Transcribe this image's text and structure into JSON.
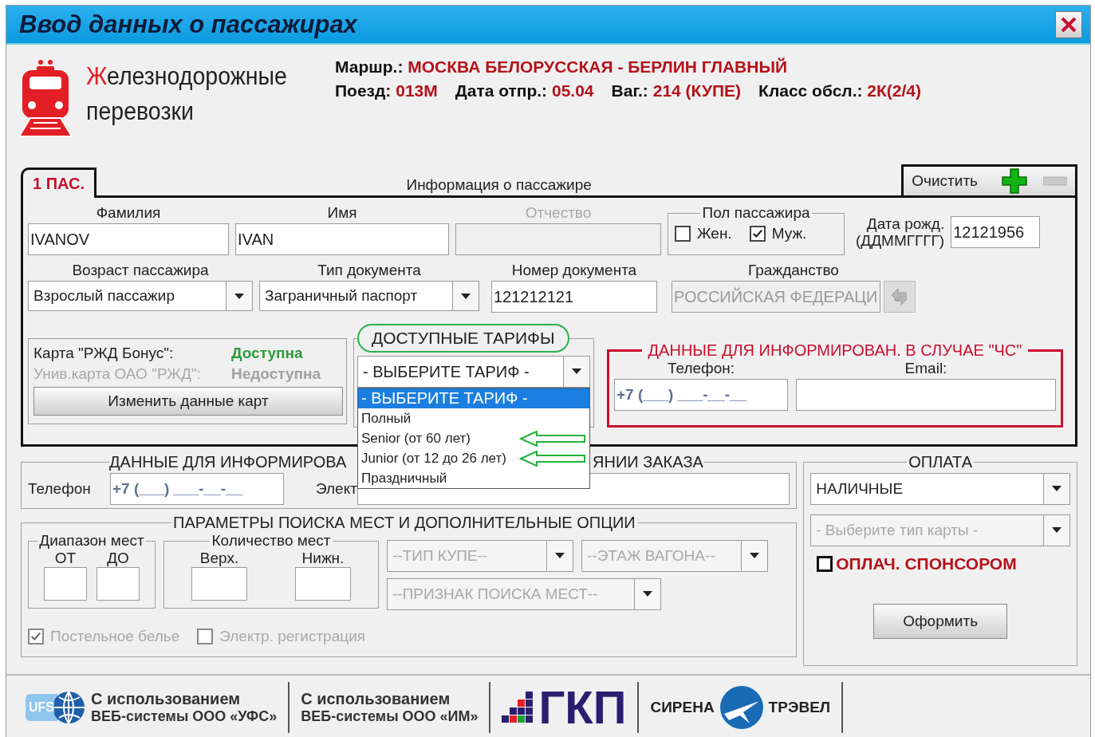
{
  "window": {
    "title": "Ввод данных о пассажирах"
  },
  "brand": {
    "lines": [
      "Железнодорожные",
      "перевозки"
    ]
  },
  "trip_lines": [
    [
      {
        "label": "Маршр.:",
        "value": "МОСКВА БЕЛОРУССКАЯ - БЕРЛИН ГЛАВНЫЙ"
      }
    ],
    [
      {
        "label": "Поезд:",
        "value": "013М"
      },
      {
        "label": "Дата отпр.:",
        "value": "05.04"
      },
      {
        "label": "Ваг.:",
        "value": "214 (КУПЕ)"
      },
      {
        "label": "Класс обсл.:",
        "value": "2К(2/4)"
      }
    ]
  ],
  "passenger": {
    "tabs": [
      {
        "label": "1 ПАС.",
        "selected": true
      }
    ],
    "panel_title": "Информация о пассажире",
    "clear_button": "Очистить",
    "surname": {
      "label": "Фамилия",
      "value": "IVANOV"
    },
    "name": {
      "label": "Имя",
      "value": "IVAN"
    },
    "patronymic": {
      "label": "Отчество",
      "disabled": true
    },
    "gender": {
      "label": "Пол пассажира",
      "options": [
        {
          "label": "Жен.",
          "checked": false
        },
        {
          "label": "Муж.",
          "checked": true
        }
      ]
    },
    "birth_date": {
      "label_lines": [
        "Дата рожд.",
        "(ДДММГГГГ)"
      ],
      "value": "12121956"
    },
    "age": {
      "label": "Возраст пассажира",
      "value": "Взрослый пассажир"
    },
    "document_type": {
      "label": "Тип документа",
      "value": "Заграничный паспорт"
    },
    "document_number": {
      "label": "Номер документа",
      "value": "121212121"
    },
    "citizenship": {
      "label": "Гражданство",
      "value": "РОССИЙСКАЯ ФЕДЕРАЦИ",
      "disabled": true
    },
    "cards": {
      "rows": [
        {
          "label": "Карта \"РЖД Бонус\":",
          "status": "Доступна",
          "available": true
        },
        {
          "label": "Унив.карта ОАО \"РЖД\":",
          "status": "Недоступна",
          "available": false
        }
      ],
      "button": "Изменить данные карт"
    },
    "tariffs": {
      "title": "ДОСТУПНЫЕ ТАРИФЫ",
      "title_circled": true,
      "value": "- ВЫБЕРИТЕ ТАРИФ -",
      "expanded": true,
      "options": [
        {
          "label": "- ВЫБЕРИТЕ ТАРИФ -",
          "selected": true,
          "marked": false
        },
        {
          "label": "Полный",
          "selected": false,
          "marked": false
        },
        {
          "label": "Senior (от 60 лет)",
          "selected": false,
          "marked": true
        },
        {
          "label": "Junior (от 12 до 26 лет)",
          "selected": false,
          "marked": true
        },
        {
          "label": "Праздничный",
          "selected": false,
          "marked": false
        }
      ]
    },
    "emergency": {
      "title": "ДАННЫЕ ДЛЯ ИНФОРМИРОВАН. В СЛУЧАЕ \"ЧС\"",
      "phone_label": "Телефон:",
      "phone_mask": "+7 (___) ___-__-__",
      "email_label": "Email:"
    }
  },
  "order_info": {
    "title_start": "ДАННЫЕ ДЛЯ ИНФОРМИРОВА",
    "title_end": "ЯНИИ ЗАКАЗА",
    "phone_label": "Телефон",
    "phone_mask": "+7 (___) ___-__-__",
    "email_label": "Элект"
  },
  "search": {
    "title": "ПАРАМЕТРЫ ПОИСКА МЕСТ И ДОПОЛНИТЕЛЬНЫЕ ОПЦИИ",
    "range": {
      "title": "Диапазон мест",
      "from": "ОТ",
      "to": "ДО"
    },
    "count": {
      "title": "Количество мест",
      "upper": "Верх.",
      "lower": "Нижн."
    },
    "combos": [
      {
        "value": "--ТИП КУПЕ--",
        "disabled": true
      },
      {
        "value": "--ЭТАЖ ВАГОНА--",
        "disabled": true
      },
      {
        "value": "--ПРИЗНАК ПОИСКА МЕСТ--",
        "disabled": true
      }
    ],
    "options": [
      {
        "label": "Постельное белье",
        "checked": true,
        "disabled": true
      },
      {
        "label": "Электр. регистрация",
        "checked": false,
        "disabled": true
      }
    ]
  },
  "payment": {
    "title": "ОПЛАТА",
    "method": "НАЛИЧНЫЕ",
    "card_type": {
      "value": "- Выберите тип карты -",
      "disabled": true
    },
    "sponsor": {
      "label": "ОПЛАЧ. СПОНСОРОМ",
      "checked": false
    },
    "submit": "Оформить"
  },
  "footer": [
    {
      "kind": "ufs",
      "logo_text": "UFS",
      "lines": [
        "С использованием",
        "ВЕБ-системы ООО «УФС»"
      ]
    },
    {
      "kind": "text",
      "lines": [
        "С использованием",
        "ВЕБ-системы ООО «ИМ»"
      ]
    },
    {
      "kind": "gkp",
      "text": "ГКП"
    },
    {
      "kind": "sirena",
      "left": "СИРЕНА",
      "right": "ТРЭВЕЛ"
    }
  ]
}
